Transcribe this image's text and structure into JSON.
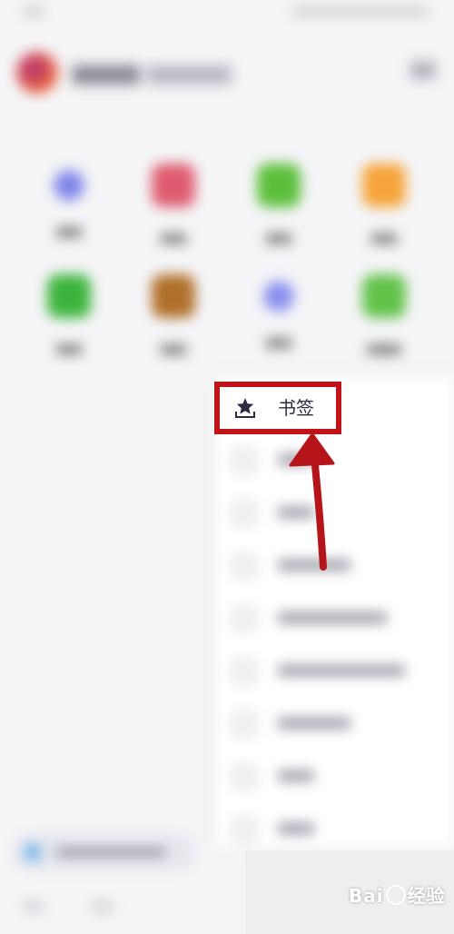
{
  "context_menu": {
    "bookmarks_label": "书签",
    "bookmarks_icon": "bookmark-star-icon"
  },
  "watermark": {
    "text_left": "Bai",
    "text_right": "经验"
  },
  "colors": {
    "highlight": "#c0141a",
    "arrow": "#b5141a",
    "panel": "#ffffff",
    "background": "#f5f5f7"
  }
}
